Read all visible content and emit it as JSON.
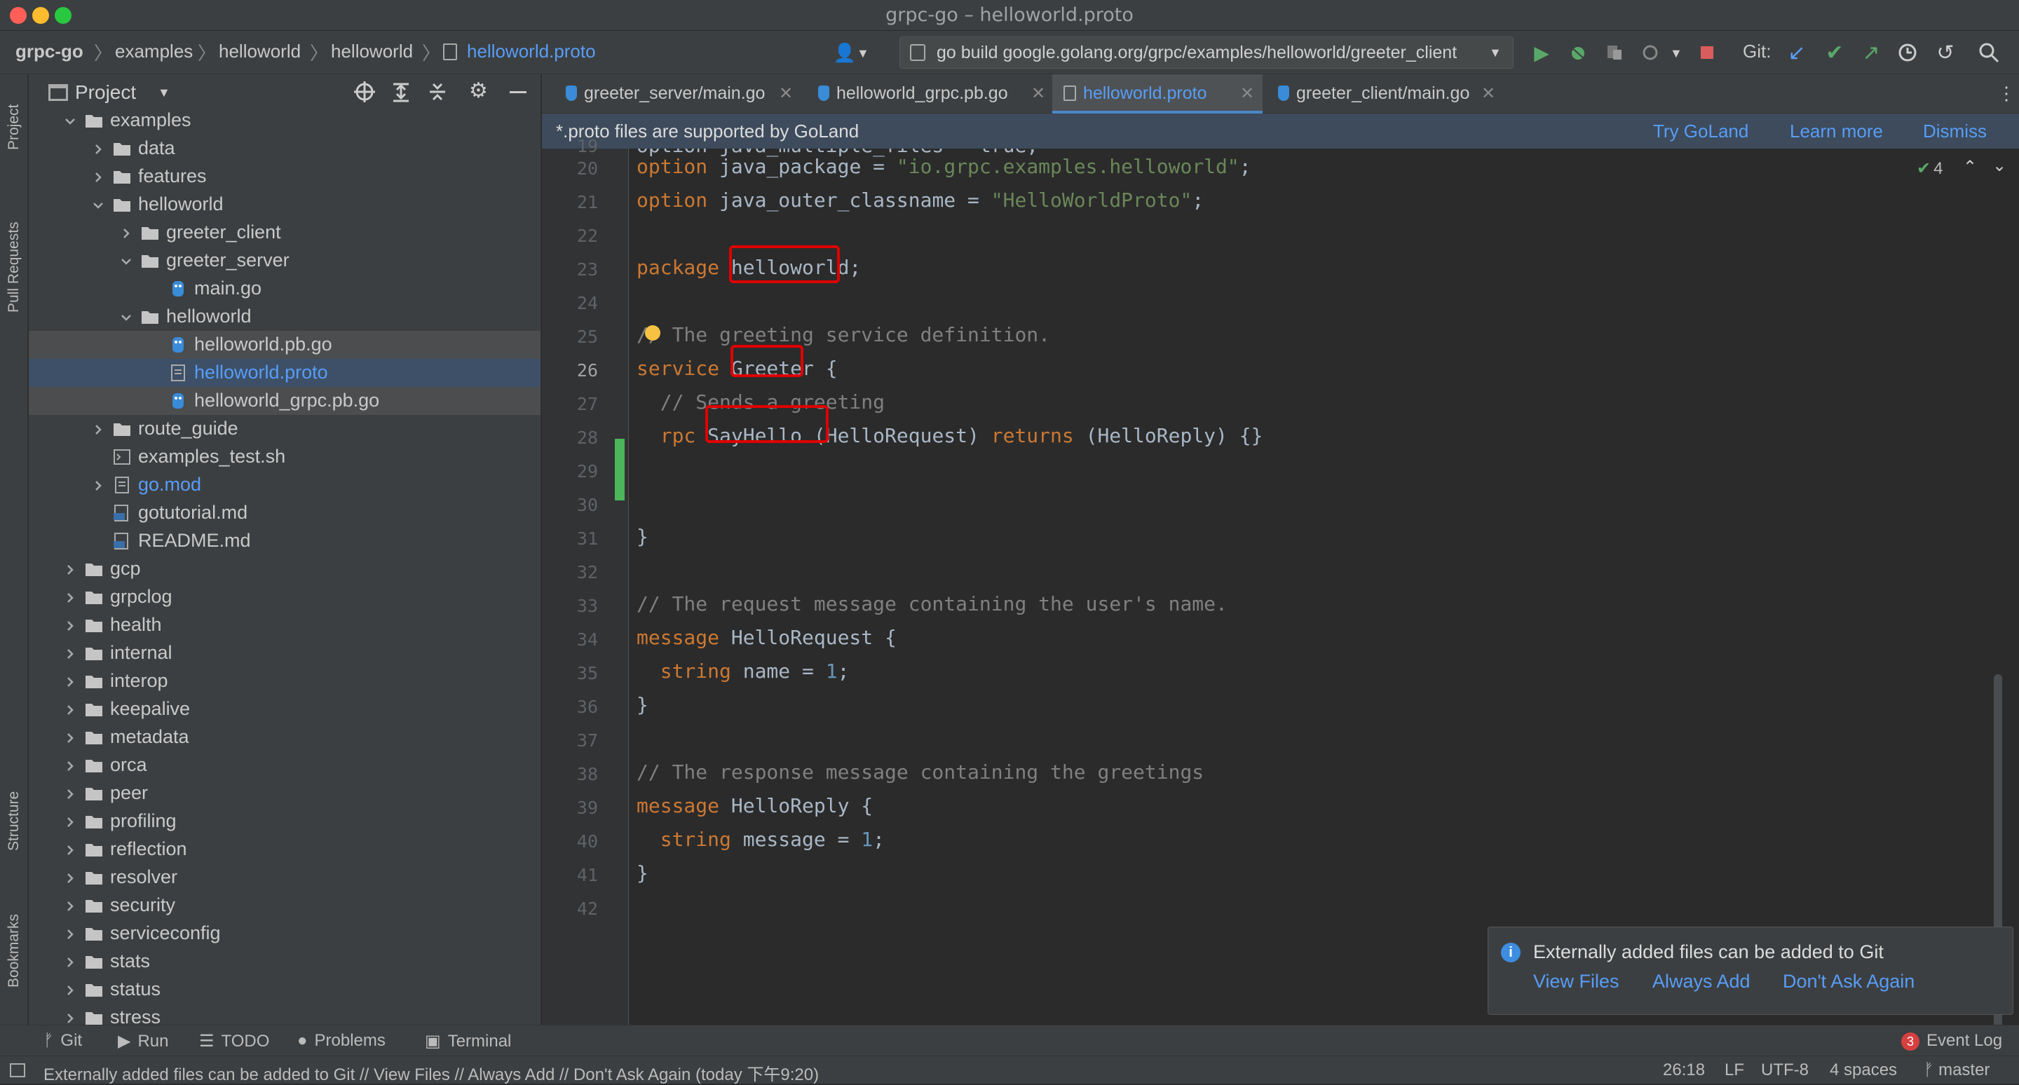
{
  "window": {
    "title": "grpc-go – helloworld.proto"
  },
  "breadcrumbs": [
    "grpc-go",
    "examples",
    "helloworld",
    "helloworld",
    "helloworld.proto"
  ],
  "run_config": "go build google.golang.org/grpc/examples/helloworld/greeter_client",
  "git_label": "Git:",
  "project_panel": {
    "title": "Project"
  },
  "side_tools": {
    "project": "Project",
    "pull_requests": "Pull Requests",
    "structure": "Structure",
    "bookmarks": "Bookmarks"
  },
  "tree": [
    {
      "label": "examples",
      "type": "folder",
      "indent": 1,
      "state": "open"
    },
    {
      "label": "data",
      "type": "folder",
      "indent": 2,
      "state": "closed"
    },
    {
      "label": "features",
      "type": "folder",
      "indent": 2,
      "state": "closed"
    },
    {
      "label": "helloworld",
      "type": "folder",
      "indent": 2,
      "state": "open"
    },
    {
      "label": "greeter_client",
      "type": "folder",
      "indent": 3,
      "state": "closed"
    },
    {
      "label": "greeter_server",
      "type": "folder",
      "indent": 3,
      "state": "open"
    },
    {
      "label": "main.go",
      "type": "go",
      "indent": 4,
      "state": "none"
    },
    {
      "label": "helloworld",
      "type": "folder",
      "indent": 3,
      "state": "open"
    },
    {
      "label": "helloworld.pb.go",
      "type": "go",
      "indent": 4,
      "state": "none",
      "sel": "1"
    },
    {
      "label": "helloworld.proto",
      "type": "proto",
      "indent": 4,
      "state": "none",
      "sel": "2",
      "blue": true
    },
    {
      "label": "helloworld_grpc.pb.go",
      "type": "go",
      "indent": 4,
      "state": "none",
      "sel": "1"
    },
    {
      "label": "route_guide",
      "type": "folder",
      "indent": 2,
      "state": "closed"
    },
    {
      "label": "examples_test.sh",
      "type": "sh",
      "indent": 2,
      "state": "none"
    },
    {
      "label": "go.mod",
      "type": "mod",
      "indent": 2,
      "state": "closed",
      "blue": true
    },
    {
      "label": "gotutorial.md",
      "type": "md",
      "indent": 2,
      "state": "none"
    },
    {
      "label": "README.md",
      "type": "md",
      "indent": 2,
      "state": "none"
    },
    {
      "label": "gcp",
      "type": "folder",
      "indent": 1,
      "state": "closed"
    },
    {
      "label": "grpclog",
      "type": "folder",
      "indent": 1,
      "state": "closed"
    },
    {
      "label": "health",
      "type": "folder",
      "indent": 1,
      "state": "closed"
    },
    {
      "label": "internal",
      "type": "folder",
      "indent": 1,
      "state": "closed"
    },
    {
      "label": "interop",
      "type": "folder",
      "indent": 1,
      "state": "closed"
    },
    {
      "label": "keepalive",
      "type": "folder",
      "indent": 1,
      "state": "closed"
    },
    {
      "label": "metadata",
      "type": "folder",
      "indent": 1,
      "state": "closed"
    },
    {
      "label": "orca",
      "type": "folder",
      "indent": 1,
      "state": "closed"
    },
    {
      "label": "peer",
      "type": "folder",
      "indent": 1,
      "state": "closed"
    },
    {
      "label": "profiling",
      "type": "folder",
      "indent": 1,
      "state": "closed"
    },
    {
      "label": "reflection",
      "type": "folder",
      "indent": 1,
      "state": "closed"
    },
    {
      "label": "resolver",
      "type": "folder",
      "indent": 1,
      "state": "closed"
    },
    {
      "label": "security",
      "type": "folder",
      "indent": 1,
      "state": "closed"
    },
    {
      "label": "serviceconfig",
      "type": "folder",
      "indent": 1,
      "state": "closed"
    },
    {
      "label": "stats",
      "type": "folder",
      "indent": 1,
      "state": "closed"
    },
    {
      "label": "status",
      "type": "folder",
      "indent": 1,
      "state": "closed"
    },
    {
      "label": "stress",
      "type": "folder",
      "indent": 1,
      "state": "closed"
    }
  ],
  "tabs": [
    {
      "label": "greeter_server/main.go",
      "active": false
    },
    {
      "label": "helloworld_grpc.pb.go",
      "active": false
    },
    {
      "label": "helloworld.proto",
      "active": true
    },
    {
      "label": "greeter_client/main.go",
      "active": false
    }
  ],
  "banner": {
    "message": "*.proto files are supported by GoLand",
    "try": "Try GoLand",
    "learn": "Learn more",
    "dismiss": "Dismiss"
  },
  "inspection_count": "4",
  "code_lines": [
    {
      "n": "20",
      "parts": [
        [
          "kw",
          "option "
        ],
        [
          "id",
          "java_package = "
        ],
        [
          "str",
          "\"io.grpc.examples.helloworld\""
        ],
        [
          "id",
          ";"
        ]
      ]
    },
    {
      "n": "21",
      "parts": [
        [
          "kw",
          "option "
        ],
        [
          "id",
          "java_outer_classname = "
        ],
        [
          "str",
          "\"HelloWorldProto\""
        ],
        [
          "id",
          ";"
        ]
      ]
    },
    {
      "n": "22",
      "parts": []
    },
    {
      "n": "23",
      "parts": [
        [
          "kw",
          "package "
        ],
        [
          "id",
          "helloworld;"
        ]
      ]
    },
    {
      "n": "24",
      "parts": []
    },
    {
      "n": "25",
      "parts": [
        [
          "cm",
          "// The greeting service definition."
        ]
      ]
    },
    {
      "n": "26",
      "parts": [
        [
          "kw",
          "service "
        ],
        [
          "id",
          "Greeter {"
        ]
      ]
    },
    {
      "n": "27",
      "parts": [
        [
          "cm",
          "  // Sends a greeting"
        ]
      ]
    },
    {
      "n": "28",
      "parts": [
        [
          "kw",
          "  rpc "
        ],
        [
          "id",
          "SayHello (HelloRequest) "
        ],
        [
          "kw",
          "returns "
        ],
        [
          "id",
          "(HelloReply) {}"
        ]
      ]
    },
    {
      "n": "29",
      "parts": []
    },
    {
      "n": "30",
      "parts": []
    },
    {
      "n": "31",
      "parts": [
        [
          "id",
          "}"
        ]
      ]
    },
    {
      "n": "32",
      "parts": []
    },
    {
      "n": "33",
      "parts": [
        [
          "cm",
          "// The request message containing the user's name."
        ]
      ]
    },
    {
      "n": "34",
      "parts": [
        [
          "kw",
          "message "
        ],
        [
          "id",
          "HelloRequest {"
        ]
      ]
    },
    {
      "n": "35",
      "parts": [
        [
          "kw",
          "  string "
        ],
        [
          "id",
          "name = "
        ],
        [
          "num",
          "1"
        ],
        [
          "id",
          ";"
        ]
      ]
    },
    {
      "n": "36",
      "parts": [
        [
          "id",
          "}"
        ]
      ]
    },
    {
      "n": "37",
      "parts": []
    },
    {
      "n": "38",
      "parts": [
        [
          "cm",
          "// The response message containing the greetings"
        ]
      ]
    },
    {
      "n": "39",
      "parts": [
        [
          "kw",
          "message "
        ],
        [
          "id",
          "HelloReply {"
        ]
      ]
    },
    {
      "n": "40",
      "parts": [
        [
          "kw",
          "  string "
        ],
        [
          "id",
          "message = "
        ],
        [
          "num",
          "1"
        ],
        [
          "id",
          ";"
        ]
      ]
    },
    {
      "n": "41",
      "parts": [
        [
          "id",
          "}"
        ]
      ]
    },
    {
      "n": "42",
      "parts": []
    }
  ],
  "partial_top_line": "option java_multiple_files = true;",
  "notification": {
    "message": "Externally added files can be added to Git",
    "view": "View Files",
    "always": "Always Add",
    "never": "Don't Ask Again"
  },
  "bottom_tools": [
    "Git",
    "Run",
    "TODO",
    "Problems",
    "Terminal"
  ],
  "event_log": {
    "count": "3",
    "label": "Event Log"
  },
  "status": {
    "message": "Externally added files can be added to Git // View Files // Always Add // Don't Ask Again (today 下午9:20)",
    "position": "26:18",
    "line_sep": "LF",
    "encoding": "UTF-8",
    "indent": "4 spaces",
    "branch": "master"
  },
  "colors": {
    "accent": "#589df6",
    "highlight_box": "#e00000",
    "change_marker": "#4cb65a"
  }
}
